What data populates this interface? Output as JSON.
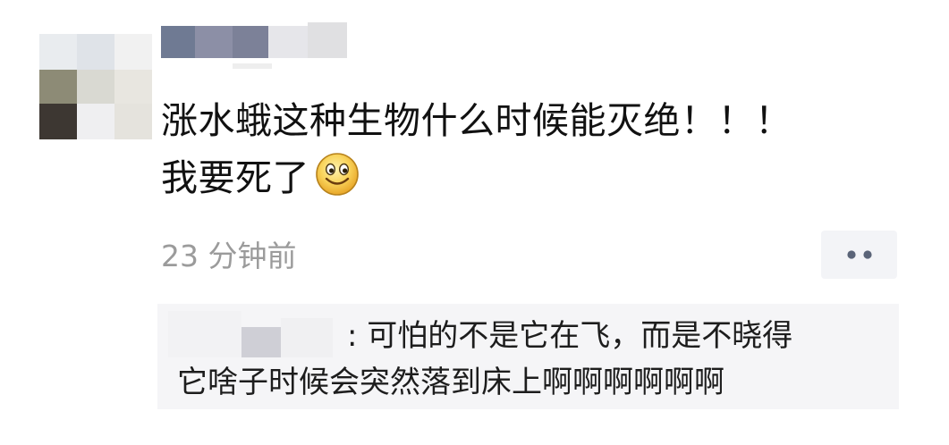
{
  "post": {
    "line1": "涨水蛾这种生物什么时候能灭绝！！！",
    "line2": "我要死了",
    "emoji": "smiley-icon",
    "timestamp": "23 分钟前"
  },
  "more_button": {
    "icon": "more-dots-icon"
  },
  "comment": {
    "line1": ": 可怕的不是它在飞，而是不晓得",
    "line2": "它啥子时候会突然落到床上啊啊啊啊啊啊"
  },
  "colors": {
    "text_primary": "#111111",
    "text_secondary": "#9b9b9b",
    "comment_bg": "#f5f5f7",
    "button_bg": "#f3f4f7",
    "dots": "#5a6478"
  }
}
